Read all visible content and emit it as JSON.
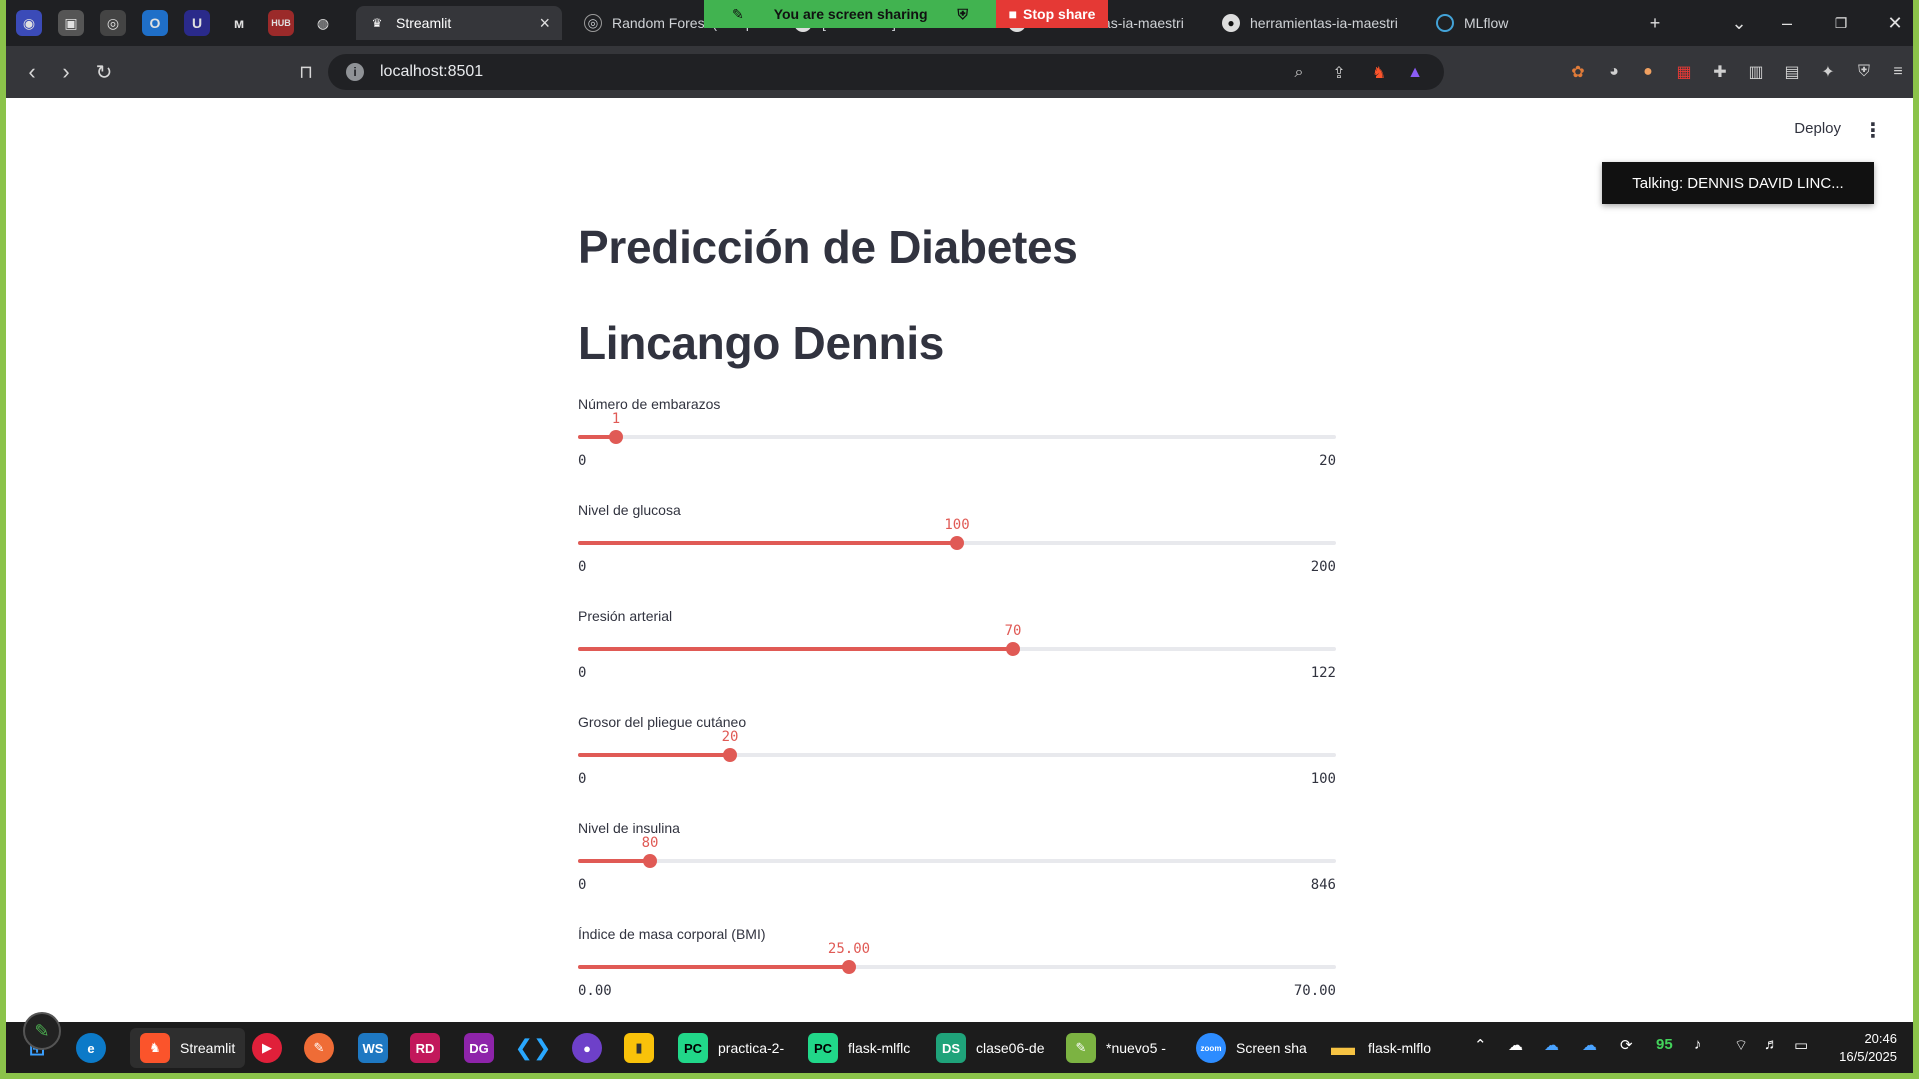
{
  "browser": {
    "tabs": [
      {
        "label": "Streamlit",
        "active": true
      },
      {
        "label": "Random Forest (Bosque",
        "active": false
      },
      {
        "label": "[MP23-Ab3] Resolu",
        "active": false
      },
      {
        "label": "herramientas-ia-maestri",
        "active": false
      },
      {
        "label": "herramientas-ia-maestri",
        "active": false
      },
      {
        "label": "MLflow",
        "active": false
      }
    ],
    "url": "localhost:8501",
    "share_banner": "You are screen sharing",
    "stop_share": "Stop share"
  },
  "app": {
    "deploy_label": "Deploy",
    "talking": "Talking: DENNIS DAVID LINC...",
    "title": "Predicción de Diabetes",
    "subtitle": "Lincango Dennis",
    "sliders": [
      {
        "label": "Número de embarazos",
        "value": "1",
        "min": "0",
        "max": "20",
        "fraction": 0.05
      },
      {
        "label": "Nivel de glucosa",
        "value": "100",
        "min": "0",
        "max": "200",
        "fraction": 0.5
      },
      {
        "label": "Presión arterial",
        "value": "70",
        "min": "0",
        "max": "122",
        "fraction": 0.5738
      },
      {
        "label": "Grosor del pliegue cutáneo",
        "value": "20",
        "min": "0",
        "max": "100",
        "fraction": 0.2
      },
      {
        "label": "Nivel de insulina",
        "value": "80",
        "min": "0",
        "max": "846",
        "fraction": 0.0946
      },
      {
        "label": "Índice de masa corporal (BMI)",
        "value": "25.00",
        "min": "0.00",
        "max": "70.00",
        "fraction": 0.3571
      }
    ],
    "accent_color": "#e05a55"
  },
  "taskbar": {
    "items": [
      {
        "label": "Streamlit"
      },
      {
        "label": "practica-2-"
      },
      {
        "label": "flask-mlflc"
      },
      {
        "label": "clase06-de"
      },
      {
        "label": "*nuevo5 -"
      },
      {
        "label": "Screen sha"
      },
      {
        "label": "flask-mlflo"
      }
    ],
    "battery_percent": "95",
    "time": "20:46",
    "date": "16/5/2025"
  }
}
